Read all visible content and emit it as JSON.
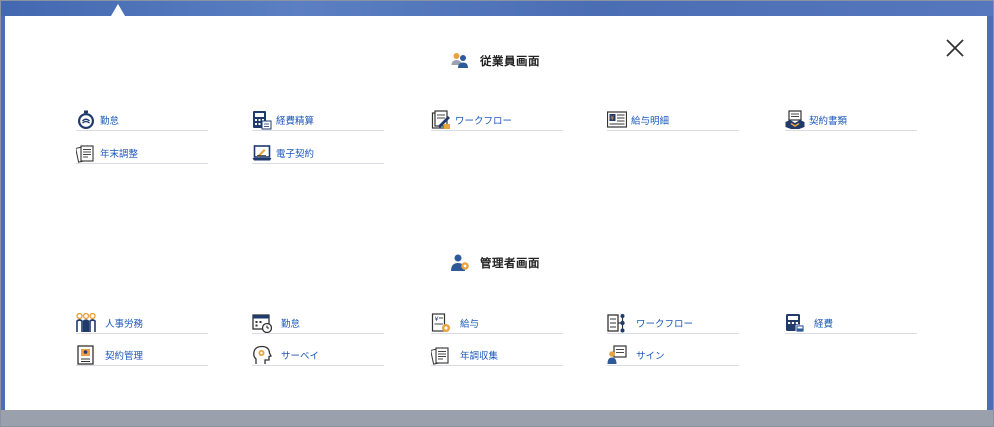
{
  "employee_section": {
    "title": "従業員画面",
    "items": [
      {
        "label": "勤怠",
        "icon": "stopwatch-icon"
      },
      {
        "label": "経費精算",
        "icon": "calculator-document-icon"
      },
      {
        "label": "ワークフロー",
        "icon": "approval-document-icon"
      },
      {
        "label": "給与明細",
        "icon": "payslip-icon"
      },
      {
        "label": "契約書類",
        "icon": "handshake-document-icon"
      },
      {
        "label": "年末調整",
        "icon": "tax-forms-icon"
      },
      {
        "label": "電子契約",
        "icon": "e-sign-laptop-icon"
      }
    ]
  },
  "admin_section": {
    "title": "管理者画面",
    "items": [
      {
        "label": "人事労務",
        "icon": "people-icon"
      },
      {
        "label": "勤怠",
        "icon": "calendar-clock-icon"
      },
      {
        "label": "給与",
        "icon": "payroll-gear-icon"
      },
      {
        "label": "ワークフロー",
        "icon": "flowchart-icon"
      },
      {
        "label": "経費",
        "icon": "calculator-icon"
      },
      {
        "label": "契約管理",
        "icon": "contract-binder-icon"
      },
      {
        "label": "サーベイ",
        "icon": "survey-head-icon"
      },
      {
        "label": "年調収集",
        "icon": "tax-collection-icon"
      },
      {
        "label": "サイン",
        "icon": "sign-person-icon"
      }
    ]
  },
  "colors": {
    "backdrop": "#4b6fb5",
    "link": "#1a57b8",
    "icon_navy": "#1f3a6b",
    "icon_gold": "#e8a33c"
  }
}
